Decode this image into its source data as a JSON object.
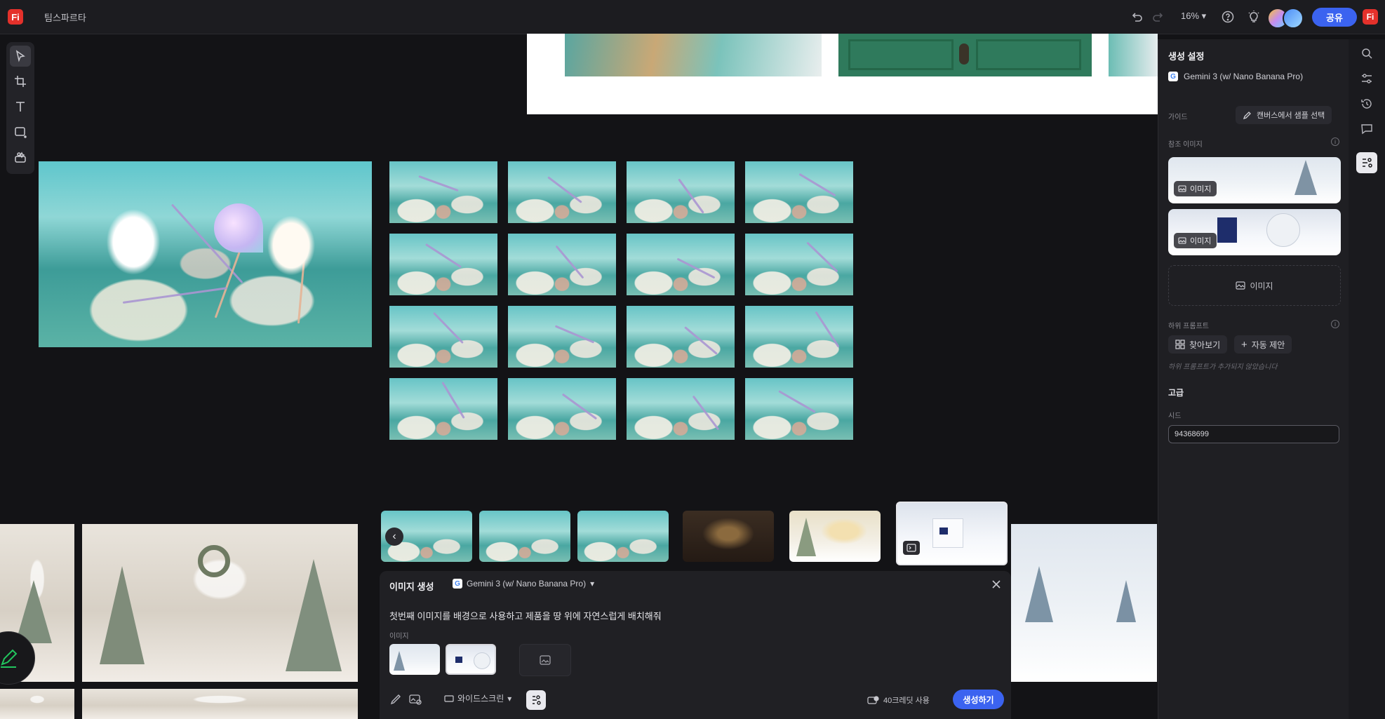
{
  "topbar": {
    "logo": "Fi",
    "team_name": "팀스파르타",
    "zoom": "16%",
    "share_label": "공유",
    "user_initials": "Fi",
    "icons": [
      "undo-icon",
      "redo-icon",
      "help-icon",
      "lightbulb-icon"
    ],
    "colors": {
      "accent": "#3b63f0",
      "brand": "#e4312b"
    }
  },
  "left_toolbar": {
    "tools": [
      "select-tool",
      "frame-tool",
      "text-tool",
      "shape-tool",
      "generate-tool"
    ]
  },
  "right_panel": {
    "title": "생성 설정",
    "model": "Gemini 3 (w/ Nano Banana Pro)",
    "guide_label": "가이드",
    "guide_button": "캔버스에서 샘플 선택",
    "ref_images_label": "참조 이미지",
    "ref_chip_label": "이미지",
    "ref_add_label": "이미지",
    "sub_prompt_label": "하위 프롬프트",
    "browse_button": "찾아보기",
    "auto_suggest_button": "자동 제안",
    "sub_prompt_empty": "하위 프롬프트가 추가되지 않았습니다",
    "advanced_label": "고급",
    "seed_label": "시드",
    "seed_value": "94368699"
  },
  "gen_panel": {
    "title": "이미지 생성",
    "model": "Gemini 3 (w/ Nano Banana Pro)",
    "prompt": "첫번째 이미지를 배경으로 사용하고 제품을 땅 위에 자연스럽게 배치해줘",
    "images_label": "이미지",
    "aspect": "와이드스크린",
    "credits": "40크레딧 사용",
    "generate_label": "생성하기"
  }
}
